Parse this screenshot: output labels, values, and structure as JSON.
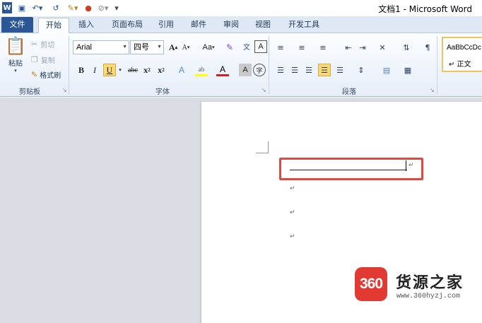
{
  "title_bar": {
    "doc_title": "文档1 - Microsoft Word",
    "app_icon": "word-icon",
    "quick_access": [
      "save-icon",
      "undo-icon",
      "redo-icon",
      "format-painter-icon",
      "color-icon",
      "clear-icon",
      "customize-icon"
    ]
  },
  "tabs": [
    {
      "label": "文件"
    },
    {
      "label": "开始"
    },
    {
      "label": "插入"
    },
    {
      "label": "页面布局"
    },
    {
      "label": "引用"
    },
    {
      "label": "邮件"
    },
    {
      "label": "审阅"
    },
    {
      "label": "视图"
    },
    {
      "label": "开发工具"
    }
  ],
  "clipboard": {
    "paste": "粘贴",
    "cut": "剪切",
    "copy": "复制",
    "format_painter": "格式刷",
    "group_label": "剪贴板"
  },
  "font": {
    "name": "Arial",
    "size": "四号",
    "grow": "A",
    "shrink": "A",
    "case": "Aa",
    "bold": "B",
    "italic": "I",
    "underline": "U",
    "strike": "abc",
    "subscript": "x",
    "superscript": "x",
    "group_label": "字体"
  },
  "paragraph": {
    "group_label": "段落"
  },
  "styles": {
    "sample": "AaBbCcDc",
    "name": "↵ 正文"
  },
  "document": {
    "para_mark": "↵"
  },
  "watermark": {
    "badge": "360",
    "name": "货源之家",
    "url": "www.360hyzj.com"
  },
  "colors": {
    "file_tab": "#2b5797",
    "highlight_border": "#e0493f",
    "watermark_red": "#e23a32"
  }
}
